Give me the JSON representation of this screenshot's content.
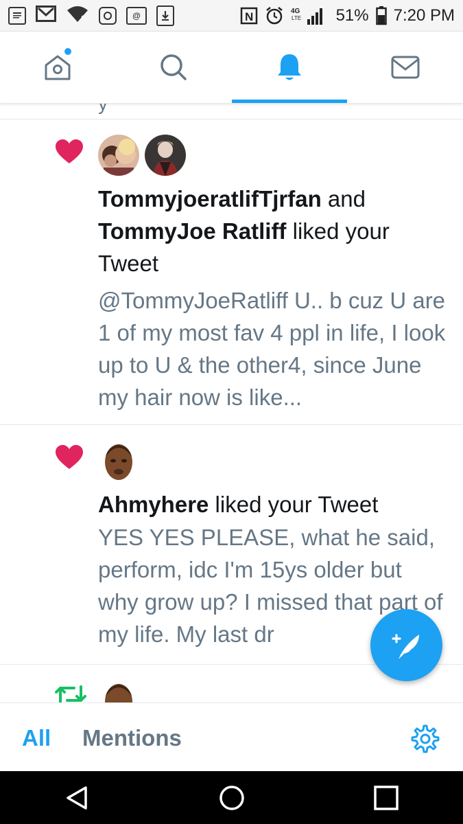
{
  "status_bar": {
    "battery": "51%",
    "time": "7:20 PM",
    "network": "4G LTE",
    "icons": [
      "news-icon",
      "gmail-icon",
      "wifi-icon",
      "sync-icon",
      "email-icon",
      "download-icon",
      "nfc-icon",
      "alarm-icon",
      "signal-icon",
      "battery-icon"
    ]
  },
  "tabs": [
    {
      "name": "home",
      "icon": "home-icon",
      "active": false,
      "has_badge": true
    },
    {
      "name": "search",
      "icon": "search-icon",
      "active": false
    },
    {
      "name": "notifications",
      "icon": "bell-icon",
      "active": true
    },
    {
      "name": "messages",
      "icon": "mail-icon",
      "active": false
    }
  ],
  "feed": {
    "notifications": [
      {
        "type": "like",
        "icon": "heart-icon",
        "avatars": [
          "avatar-tommyjoeratlif-tjrfan",
          "avatar-tommyjoe-ratliff"
        ],
        "actor1": "TommyjoeratlifTjrfan",
        "connector": " and ",
        "actor2": "TommyJoe Ratliff",
        "action": " liked your Tweet",
        "snippet": "@TommyJoeRatliff U.. b cuz U are 1 of my most fav 4 ppl in life, I look up to U & the other4, since June my hair now is like..."
      },
      {
        "type": "like",
        "icon": "heart-icon",
        "avatars": [
          "avatar-ahmyhere"
        ],
        "actor1": "Ahmyhere",
        "action": " liked your Tweet",
        "snippet": "YES YES PLEASE, what he said, perform, idc I'm 15ys older but why grow up? I missed that part of my life. My last dr"
      },
      {
        "type": "retweet",
        "icon": "retweet-icon",
        "avatars": [
          "avatar-ahmyhere"
        ]
      }
    ]
  },
  "filters": {
    "all": "All",
    "mentions": "Mentions",
    "active": "all"
  },
  "colors": {
    "accent": "#1da1f2",
    "heart": "#e0245e",
    "retweet": "#17bf63",
    "secondary_text": "#657786"
  }
}
